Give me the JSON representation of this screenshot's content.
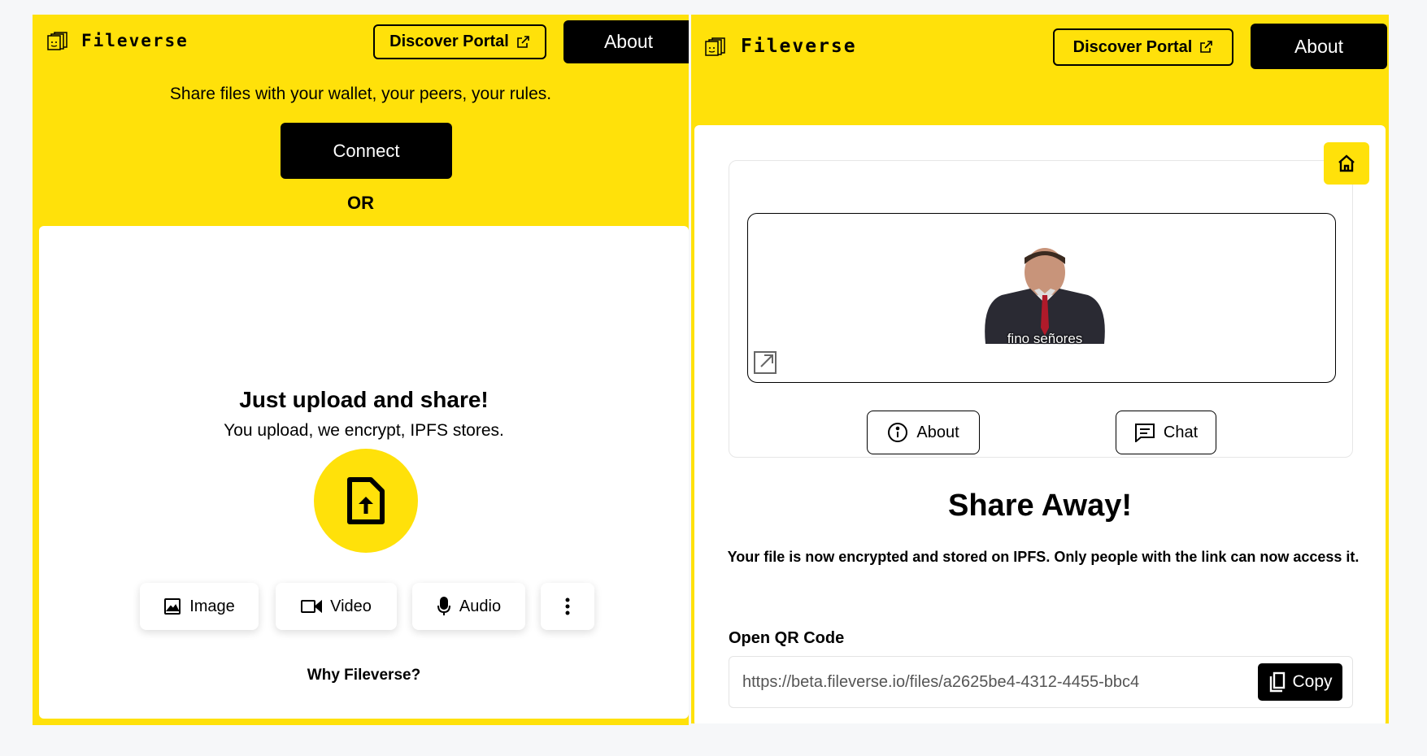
{
  "colors": {
    "brand_yellow": "#ffe10a",
    "black": "#000000",
    "white": "#ffffff",
    "background": "#f6f7f9"
  },
  "left": {
    "header": {
      "brand_name": "Fileverse",
      "brand_icon": "file-stack-icon",
      "discover_label": "Discover Portal",
      "discover_icon": "external-link-icon",
      "about_label": "About"
    },
    "tagline": "Share files with your wallet, your peers, your rules.",
    "connect_label": "Connect",
    "or_label": "OR",
    "upload": {
      "title": "Just upload and share!",
      "subtitle": "You upload, we encrypt, IPFS stores.",
      "icon": "file-upload-icon"
    },
    "types": [
      {
        "label": "Image",
        "icon": "image-icon"
      },
      {
        "label": "Video",
        "icon": "video-icon"
      },
      {
        "label": "Audio",
        "icon": "microphone-icon"
      }
    ],
    "more_icon": "more-vertical-icon",
    "why_label": "Why Fileverse?"
  },
  "right": {
    "header": {
      "brand_name": "Fileverse",
      "brand_icon": "file-stack-icon",
      "discover_label": "Discover Portal",
      "discover_icon": "external-link-icon",
      "about_label": "About"
    },
    "home_icon": "home-icon",
    "preview": {
      "caption": "fino señores",
      "open_icon": "open-external-icon"
    },
    "about_label": "About",
    "about_icon": "info-icon",
    "chat_label": "Chat",
    "chat_icon": "chat-icon",
    "share_title": "Share Away!",
    "share_desc": "Your file is now encrypted and stored on IPFS. Only people with the link can now access it.",
    "qr_label": "Open QR Code",
    "link": "https://beta.fileverse.io/files/a2625be4-4312-4455-bbc4",
    "copy_label": "Copy",
    "copy_icon": "copy-icon"
  }
}
